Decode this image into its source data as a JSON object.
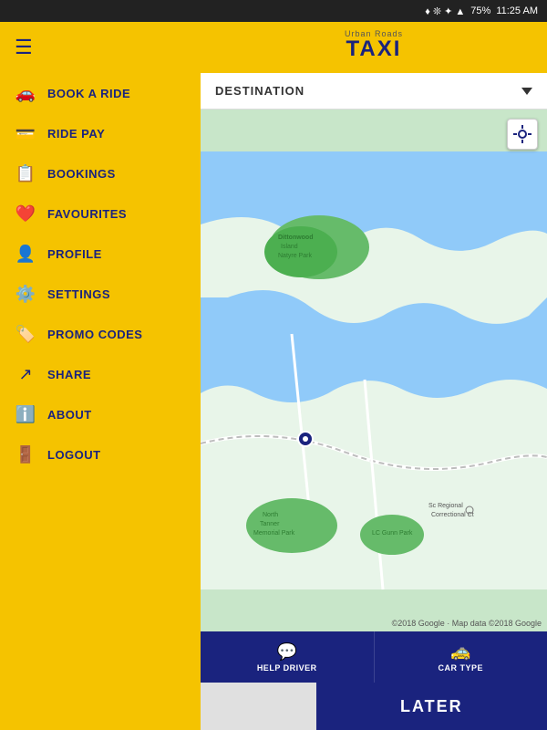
{
  "statusBar": {
    "icons": [
      "location",
      "bluetooth",
      "wifi",
      "battery"
    ],
    "battery": "75%",
    "time": "11:25 AM"
  },
  "header": {
    "subtitle": "Urban Roads",
    "title": "TAXI"
  },
  "destination": {
    "label": "DESTINATION",
    "chevron": "▼"
  },
  "sidebar": {
    "hamburger": "☰",
    "navItems": [
      {
        "id": "book-ride",
        "label": "BOOK A RIDE",
        "icon": "🚗"
      },
      {
        "id": "ride-pay",
        "label": "RIDE PAY",
        "icon": "💳"
      },
      {
        "id": "bookings",
        "label": "BOOKINGS",
        "icon": "📋"
      },
      {
        "id": "favourites",
        "label": "FAVOURITES",
        "icon": "❤️"
      },
      {
        "id": "profile",
        "label": "PROFILE",
        "icon": "👤"
      },
      {
        "id": "settings",
        "label": "SETTINGS",
        "icon": "⚙️"
      },
      {
        "id": "promo-codes",
        "label": "PROMO CODES",
        "icon": "🏷️"
      },
      {
        "id": "share",
        "label": "SHARE",
        "icon": "↗"
      },
      {
        "id": "about",
        "label": "ABOUT",
        "icon": "ℹ️"
      },
      {
        "id": "logout",
        "label": "LOGOUT",
        "icon": "🚪"
      }
    ]
  },
  "map": {
    "credit": "©2018 Google · Map data ©2018 Google",
    "locationBtn": "⊕"
  },
  "bottomTabs": [
    {
      "id": "help-driver",
      "label": "HELP DRIVER",
      "icon": "💬"
    },
    {
      "id": "car-type",
      "label": "CAR TYPE",
      "icon": "🚕"
    }
  ],
  "bottomAction": {
    "laterLabel": "LATER"
  }
}
